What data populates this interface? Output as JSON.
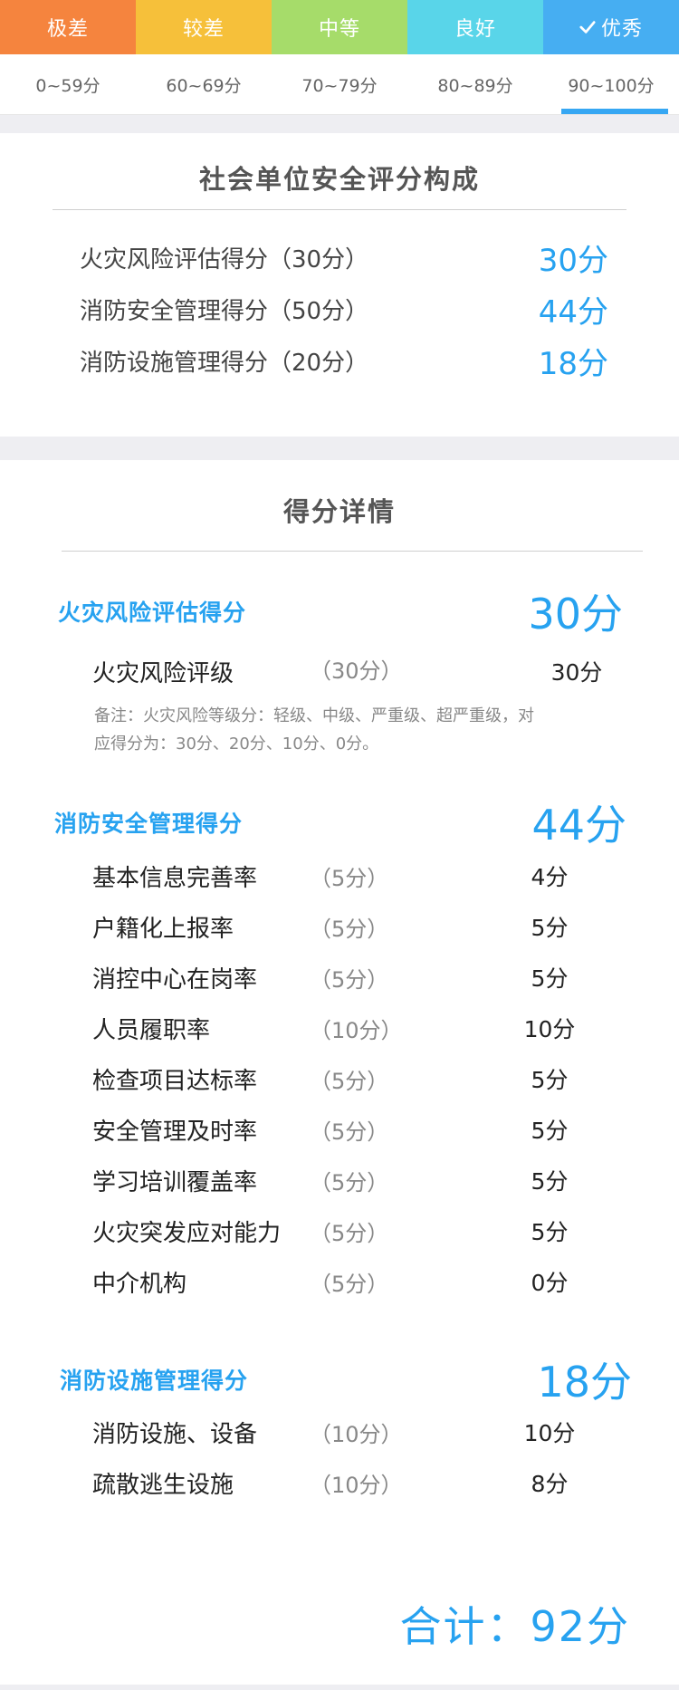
{
  "rating_levels": [
    {
      "label": "极差",
      "range": "0~59分",
      "color": "#f5843e"
    },
    {
      "label": "较差",
      "range": "60~69分",
      "color": "#f6c03a"
    },
    {
      "label": "中等",
      "range": "70~79分",
      "color": "#a6dc6a"
    },
    {
      "label": "良好",
      "range": "80~89分",
      "color": "#59d5e9"
    },
    {
      "label": "优秀",
      "range": "90~100分",
      "color": "#46aef2"
    }
  ],
  "composition": {
    "title": "社会单位安全评分构成",
    "items": [
      {
        "label": "火灾风险评估得分（30分）",
        "value": "30分"
      },
      {
        "label": "消防安全管理得分（50分）",
        "value": "44分"
      },
      {
        "label": "消防设施管理得分（20分）",
        "value": "18分"
      }
    ]
  },
  "details": {
    "title": "得分详情",
    "groups": [
      {
        "name": "火灾风险评估得分",
        "score": "30分",
        "items": [
          {
            "label": "火灾风险评级",
            "max": "（30分）",
            "score": "30分"
          }
        ],
        "note": "备注：火灾风险等级分：轻级、中级、严重级、超严重级，对应得分为：30分、20分、10分、0分。"
      },
      {
        "name": "消防安全管理得分",
        "score": "44分",
        "items": [
          {
            "label": "基本信息完善率",
            "max": "（5分）",
            "score": "4分"
          },
          {
            "label": "户籍化上报率",
            "max": "（5分）",
            "score": "5分"
          },
          {
            "label": "消控中心在岗率",
            "max": "（5分）",
            "score": "5分"
          },
          {
            "label": "人员履职率",
            "max": "（10分）",
            "score": "10分"
          },
          {
            "label": "检查项目达标率",
            "max": "（5分）",
            "score": "5分"
          },
          {
            "label": "安全管理及时率",
            "max": "（5分）",
            "score": "5分"
          },
          {
            "label": "学习培训覆盖率",
            "max": "（5分）",
            "score": "5分"
          },
          {
            "label": "火灾突发应对能力",
            "max": "（5分）",
            "score": "5分"
          },
          {
            "label": "中介机构",
            "max": "（5分）",
            "score": "0分"
          }
        ]
      },
      {
        "name": "消防设施管理得分",
        "score": "18分",
        "items": [
          {
            "label": "消防设施、设备",
            "max": "（10分）",
            "score": "10分"
          },
          {
            "label": "疏散逃生设施",
            "max": "（10分）",
            "score": "8分"
          }
        ]
      }
    ],
    "total": "合计：92分"
  }
}
